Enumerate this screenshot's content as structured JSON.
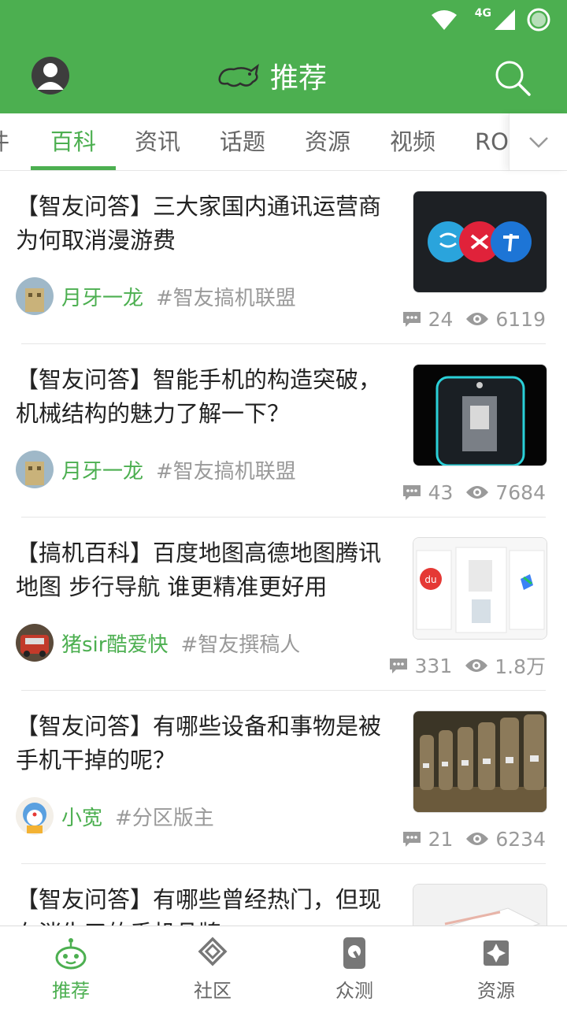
{
  "app": {
    "title": "推荐",
    "status_network": "4G",
    "accent": "#4caf50"
  },
  "tabs": [
    {
      "label": "件"
    },
    {
      "label": "百科"
    },
    {
      "label": "资讯"
    },
    {
      "label": "话题"
    },
    {
      "label": "资源"
    },
    {
      "label": "视频"
    },
    {
      "label": "ROM"
    }
  ],
  "active_tab": "百科",
  "feed": [
    {
      "title": "【智友问答】三大家国内通讯运营商为何取消漫游费",
      "author": "月牙一龙",
      "tag": "#智友搞机联盟",
      "comments": "24",
      "views": "6119",
      "thumb": "carrier-logos"
    },
    {
      "title": "【智友问答】智能手机的构造突破，机械结构的魅力了解一下？",
      "author": "月牙一龙",
      "tag": "#智友搞机联盟",
      "comments": "43",
      "views": "7684",
      "thumb": "phone-mechanism"
    },
    {
      "title": "【搞机百科】百度地图高德地图腾讯地图 步行导航 谁更精准更好用",
      "author": "猪sir酷爱快",
      "tag": "#智友撰稿人",
      "comments": "331",
      "views": "1.8万",
      "thumb": "map-apps",
      "thumb_badge": "du"
    },
    {
      "title": "【智友问答】有哪些设备和事物是被手机干掉的呢？",
      "author": "小宽",
      "tag": "#分区版主",
      "comments": "21",
      "views": "6234",
      "thumb": "terracotta-phones"
    },
    {
      "title": "【智友问答】有哪些曾经热门，但现在消失了的手机品牌",
      "author": "",
      "tag": "",
      "comments": "",
      "views": "",
      "thumb": "phone-white"
    }
  ],
  "bottom_nav": [
    {
      "label": "推荐",
      "icon": "robot-icon"
    },
    {
      "label": "社区",
      "icon": "diamond-icon"
    },
    {
      "label": "众测",
      "icon": "phone-test-icon"
    },
    {
      "label": "资源",
      "icon": "puzzle-icon"
    }
  ]
}
